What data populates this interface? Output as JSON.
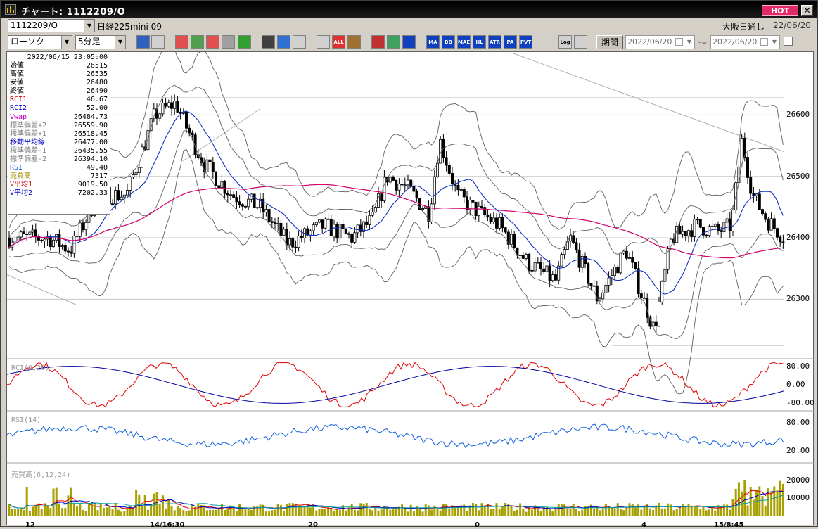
{
  "window": {
    "title": "チャート: 1112209/O",
    "hot_label": "HOT",
    "close_label": "✕"
  },
  "header": {
    "code": "1112209/O",
    "name": "日経225mini 09",
    "session": "大阪日通し",
    "date": "22/06/20"
  },
  "toolbar": {
    "chart_type": "ローソク",
    "interval": "5分足",
    "buttons": [
      {
        "icon": "zoom-icon",
        "label": "",
        "color": "#3060c0"
      },
      {
        "icon": "cursor-icon",
        "label": "",
        "color": "#d0d0d0"
      },
      {
        "icon": "candle-icon",
        "label": "",
        "color": "#e05050"
      },
      {
        "icon": "bars-icon",
        "label": "",
        "color": "#50a050"
      },
      {
        "icon": "ohlc-icon",
        "label": "",
        "color": "#e05050"
      },
      {
        "icon": "lock-icon",
        "label": "",
        "color": "#a0a0a0"
      },
      {
        "icon": "line-tool-icon",
        "label": "",
        "color": "#30a030"
      },
      {
        "icon": "arrow-tool-icon",
        "label": "",
        "color": "#404040"
      },
      {
        "icon": "pen-icon",
        "label": "",
        "color": "#3070d0"
      },
      {
        "icon": "candle-view-icon",
        "label": "",
        "color": "#d0d0d0"
      },
      {
        "icon": "candle-split-icon",
        "label": "",
        "color": "#d0d0d0"
      },
      {
        "icon": "all-icon",
        "label": "ALL",
        "color": "#e03030"
      },
      {
        "icon": "gear-icon",
        "label": "",
        "color": "#a07030"
      },
      {
        "icon": "brush-icon",
        "label": "",
        "color": "#c03030"
      },
      {
        "icon": "palette-icon",
        "label": "",
        "color": "#40a060"
      },
      {
        "icon": "grid-icon",
        "label": "",
        "color": "#1040c0"
      },
      {
        "icon": "ma-icon",
        "label": "MA",
        "color": "#1040c0"
      },
      {
        "icon": "bb-icon",
        "label": "BB",
        "color": "#1040c0"
      },
      {
        "icon": "mae-icon",
        "label": "MAE",
        "color": "#1040c0"
      },
      {
        "icon": "hl-icon",
        "label": "HL",
        "color": "#1040c0"
      },
      {
        "icon": "atr-icon",
        "label": "ATR",
        "color": "#1040c0"
      },
      {
        "icon": "para-icon",
        "label": "PA RA",
        "color": "#1040c0"
      },
      {
        "icon": "pvt-icon",
        "label": "PVT",
        "color": "#1040c0"
      },
      {
        "icon": "log-icon",
        "label": "Log",
        "color": "#d0d0d0"
      },
      {
        "icon": "export-icon",
        "label": "",
        "color": "#d0d0d0"
      }
    ],
    "period_label": "期間",
    "date_from": "2022/06/20",
    "tilde": "〜",
    "date_to": "2022/06/20"
  },
  "info_panel": {
    "datetime": "2022/06/15 23:05:00",
    "rows": [
      {
        "label": "始値",
        "value": "26515",
        "color": "#000000"
      },
      {
        "label": "高値",
        "value": "26535",
        "color": "#000000"
      },
      {
        "label": "安値",
        "value": "26480",
        "color": "#000000"
      },
      {
        "label": "終値",
        "value": "26490",
        "color": "#000000"
      },
      {
        "label": "RCI1",
        "value": "46.67",
        "color": "#d00000"
      },
      {
        "label": "RCI2",
        "value": "52.00",
        "color": "#0000c0"
      },
      {
        "label": "Vwap",
        "value": "26484.73",
        "color": "#c000c0"
      },
      {
        "label": "標準偏差+2",
        "value": "26559.90",
        "color": "#808080"
      },
      {
        "label": "標準偏差+1",
        "value": "26518.45",
        "color": "#808080"
      },
      {
        "label": "移動平均線",
        "value": "26477.00",
        "color": "#0000c0"
      },
      {
        "label": "標準偏差-1",
        "value": "26435.55",
        "color": "#808080"
      },
      {
        "label": "標準偏差-2",
        "value": "26394.10",
        "color": "#808080"
      },
      {
        "label": "RSI",
        "value": "49.40",
        "color": "#0050d0"
      },
      {
        "label": "売買高",
        "value": "7317",
        "color": "#a09000"
      },
      {
        "label": "V平均1",
        "value": "9019.50",
        "color": "#d00000"
      },
      {
        "label": "V平均2",
        "value": "7202.33",
        "color": "#0000c0"
      }
    ]
  },
  "chart_data": [
    {
      "type": "candlestick",
      "y_ticks": [
        "26600",
        "26500",
        "26400",
        "26300"
      ],
      "ylim": [
        26210,
        26700
      ],
      "x_labels": [
        "12",
        "14/16:30",
        "20",
        "0",
        "4",
        "15/8:45"
      ],
      "series_colors": {
        "vwap": "#d0006a",
        "ma": "#1030c0",
        "bands": "#606060"
      }
    },
    {
      "type": "line",
      "title": "RCI(9,26)",
      "y_ticks": [
        "80.00",
        "0.00",
        "-80.00"
      ],
      "ylim": [
        -100,
        100
      ],
      "series_colors": {
        "rci1": "#e00000",
        "rci2": "#0000a0"
      }
    },
    {
      "type": "line",
      "title": "RSI(14)",
      "y_ticks": [
        "80.00",
        "20.00"
      ],
      "ylim": [
        0,
        100
      ],
      "series_colors": {
        "rsi": "#1060e0"
      }
    },
    {
      "type": "bar",
      "title": "売買高(6,12,24)",
      "y_ticks": [
        "20000",
        "10000"
      ],
      "ylim": [
        0,
        28000
      ],
      "series_colors": {
        "volume": "#a8a000",
        "v1": "#e00000",
        "v2": "#0000c0",
        "v3": "#00a0a0"
      }
    }
  ]
}
